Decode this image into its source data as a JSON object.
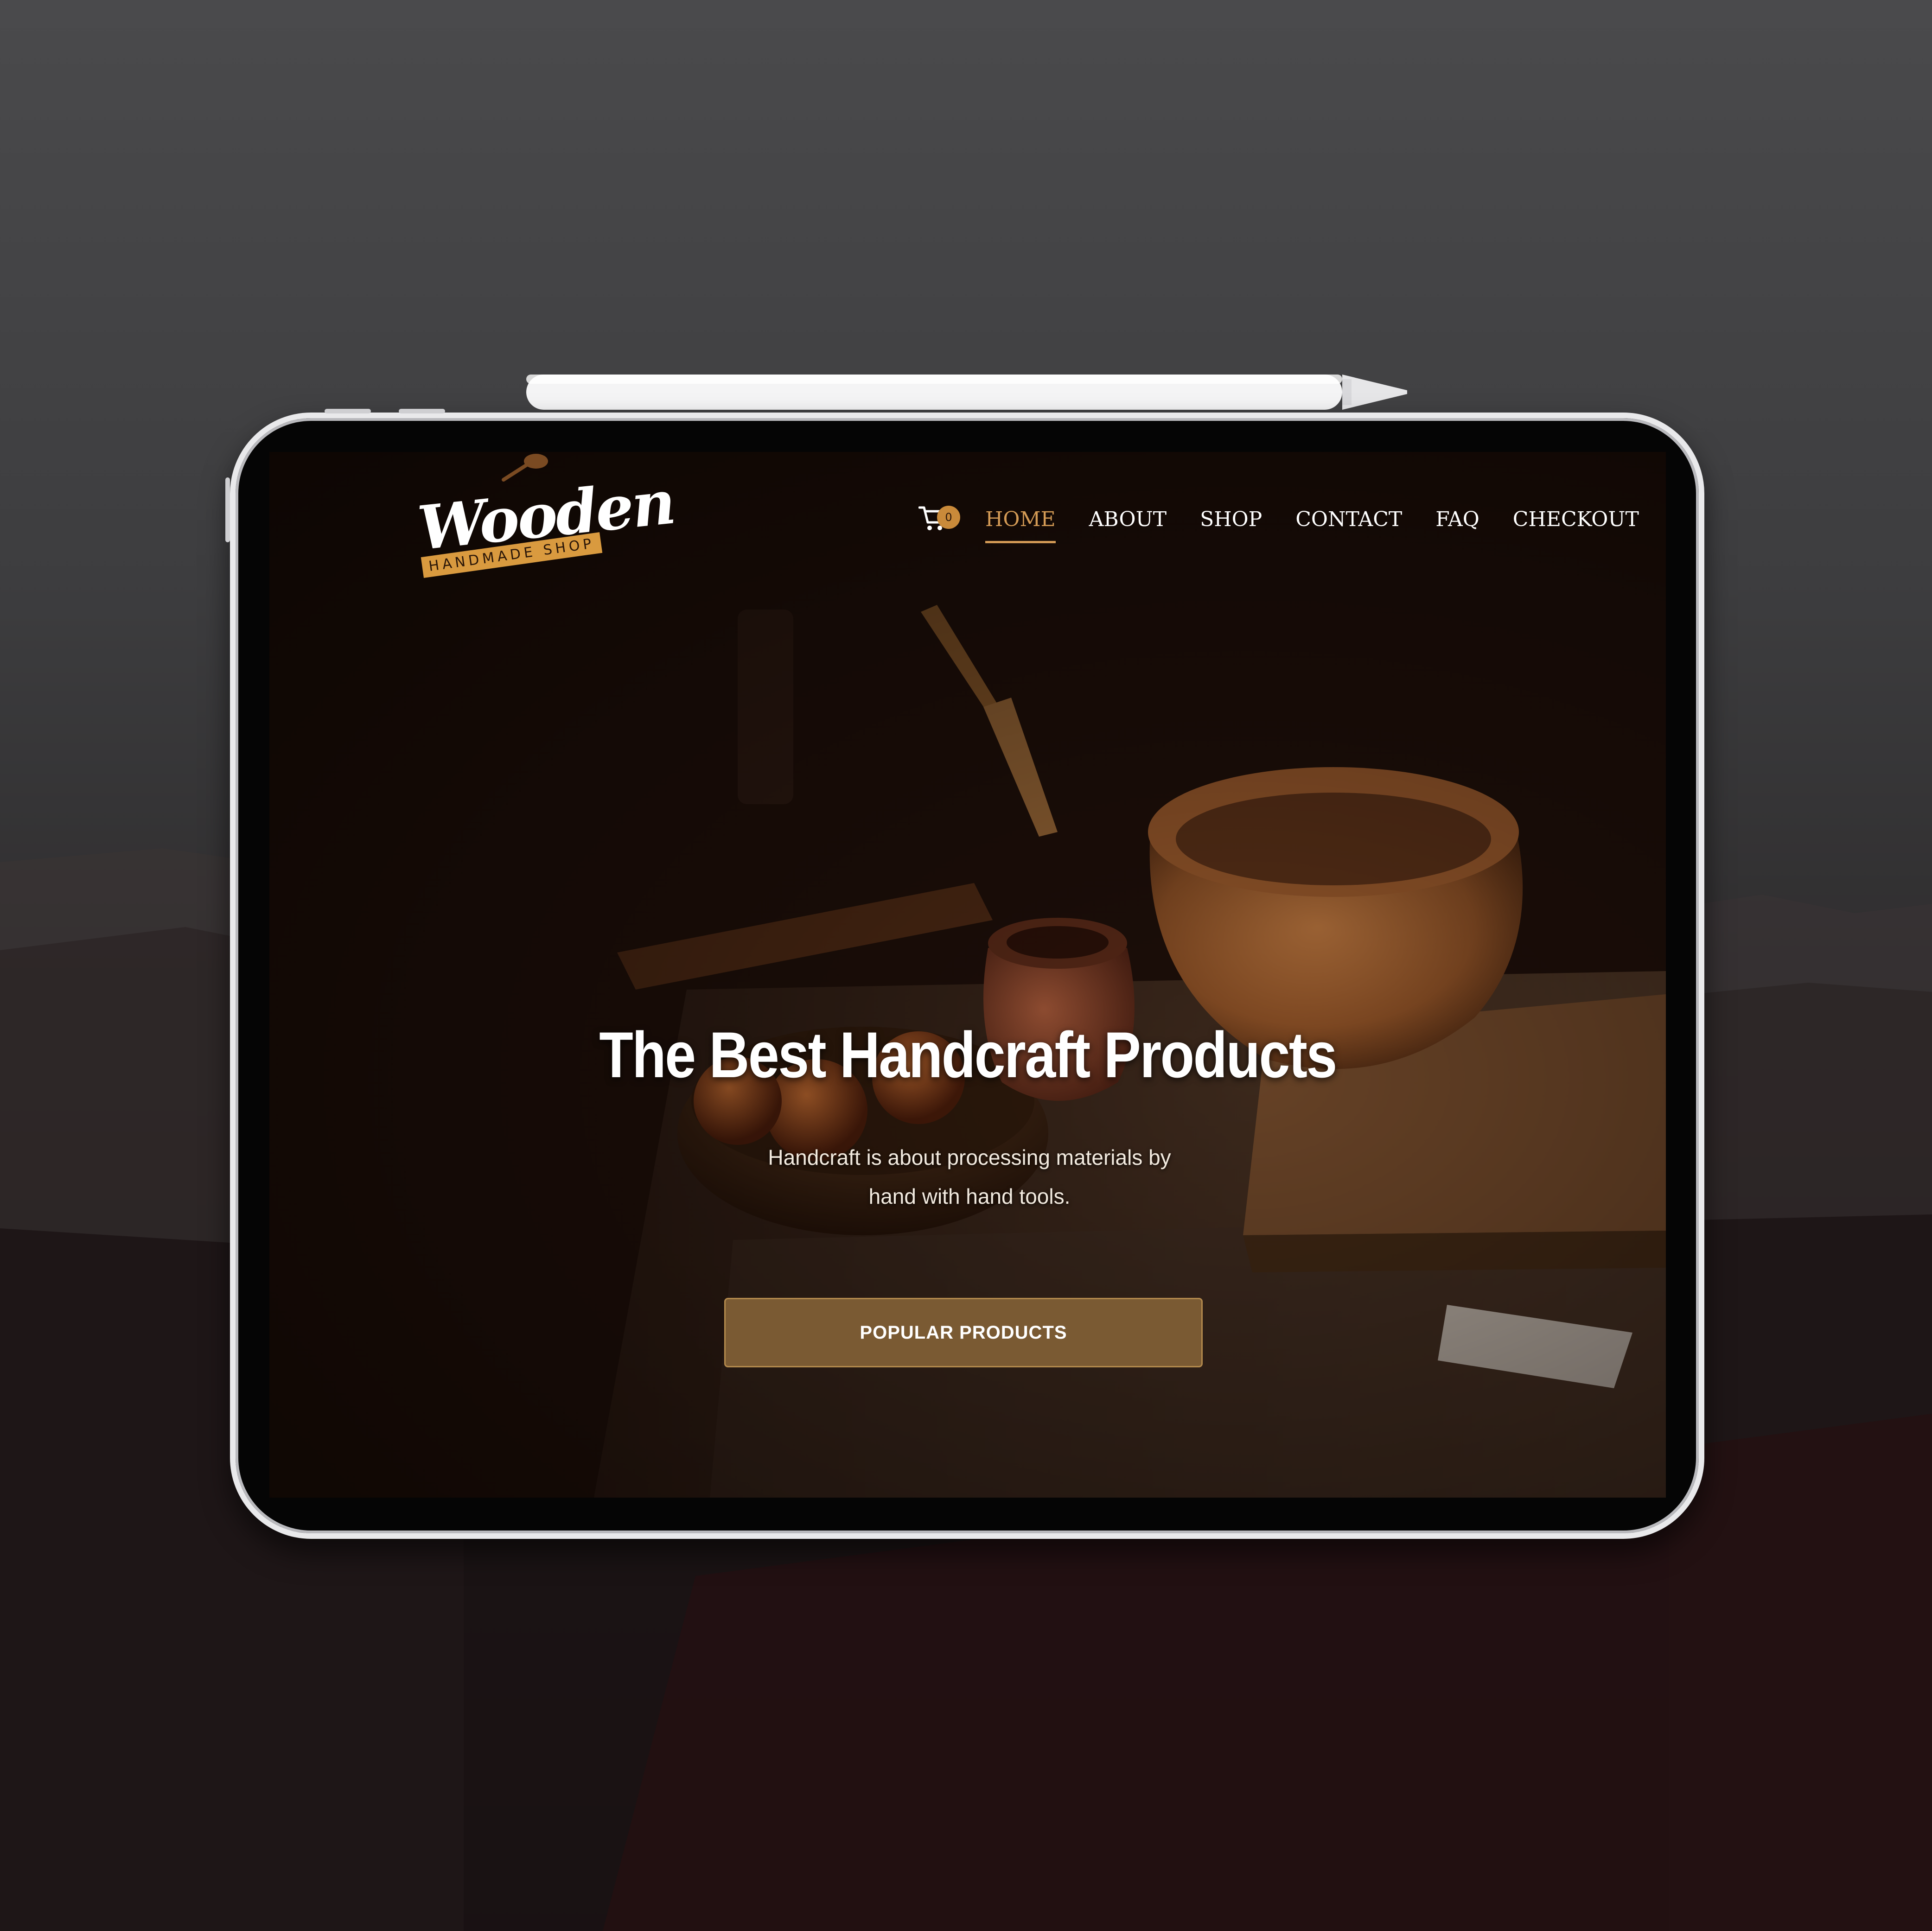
{
  "site": {
    "logo": {
      "wordmark": "Wooden",
      "tagline": "HANDMADE SHOP"
    },
    "cart": {
      "icon": "cart-icon",
      "count": "0"
    },
    "nav": {
      "items": [
        {
          "label": "HOME",
          "active": true
        },
        {
          "label": "ABOUT",
          "active": false
        },
        {
          "label": "SHOP",
          "active": false
        },
        {
          "label": "CONTACT",
          "active": false
        },
        {
          "label": "FAQ",
          "active": false
        },
        {
          "label": "CHECKOUT",
          "active": false
        }
      ]
    },
    "hero": {
      "title": "The Best Handcraft Products",
      "subtitle": "Handcraft is about processing materials by hand with hand tools.",
      "cta_label": "POPULAR PRODUCTS"
    }
  },
  "colors": {
    "accent": "#d39a55",
    "badge": "#c98a3a",
    "cta_bg": "#7a5a33",
    "cta_border": "#b48a4d",
    "hero_bg": "#1b0f0a"
  }
}
